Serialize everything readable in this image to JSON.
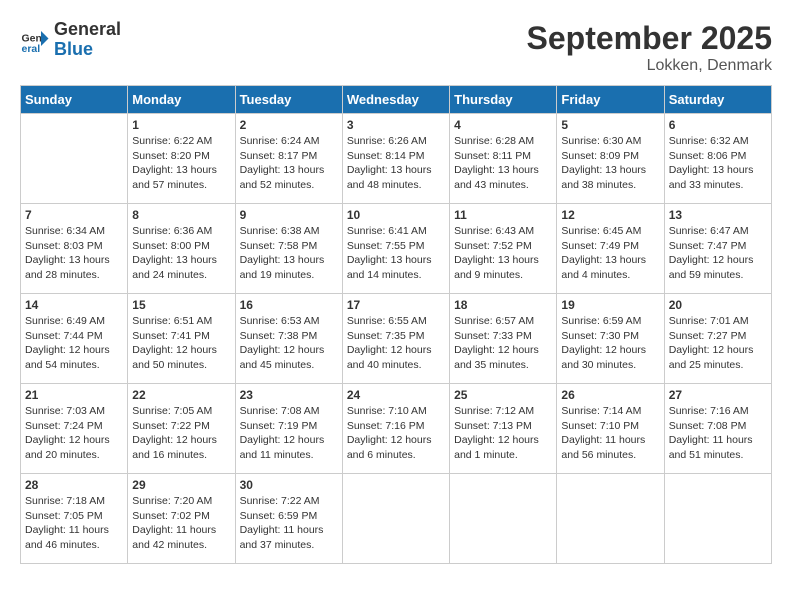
{
  "logo": {
    "general": "General",
    "blue": "Blue"
  },
  "title": "September 2025",
  "subtitle": "Lokken, Denmark",
  "days_header": [
    "Sunday",
    "Monday",
    "Tuesday",
    "Wednesday",
    "Thursday",
    "Friday",
    "Saturday"
  ],
  "weeks": [
    [
      {
        "day": "",
        "content": ""
      },
      {
        "day": "1",
        "sunrise": "Sunrise: 6:22 AM",
        "sunset": "Sunset: 8:20 PM",
        "daylight": "Daylight: 13 hours and 57 minutes."
      },
      {
        "day": "2",
        "sunrise": "Sunrise: 6:24 AM",
        "sunset": "Sunset: 8:17 PM",
        "daylight": "Daylight: 13 hours and 52 minutes."
      },
      {
        "day": "3",
        "sunrise": "Sunrise: 6:26 AM",
        "sunset": "Sunset: 8:14 PM",
        "daylight": "Daylight: 13 hours and 48 minutes."
      },
      {
        "day": "4",
        "sunrise": "Sunrise: 6:28 AM",
        "sunset": "Sunset: 8:11 PM",
        "daylight": "Daylight: 13 hours and 43 minutes."
      },
      {
        "day": "5",
        "sunrise": "Sunrise: 6:30 AM",
        "sunset": "Sunset: 8:09 PM",
        "daylight": "Daylight: 13 hours and 38 minutes."
      },
      {
        "day": "6",
        "sunrise": "Sunrise: 6:32 AM",
        "sunset": "Sunset: 8:06 PM",
        "daylight": "Daylight: 13 hours and 33 minutes."
      }
    ],
    [
      {
        "day": "7",
        "sunrise": "Sunrise: 6:34 AM",
        "sunset": "Sunset: 8:03 PM",
        "daylight": "Daylight: 13 hours and 28 minutes."
      },
      {
        "day": "8",
        "sunrise": "Sunrise: 6:36 AM",
        "sunset": "Sunset: 8:00 PM",
        "daylight": "Daylight: 13 hours and 24 minutes."
      },
      {
        "day": "9",
        "sunrise": "Sunrise: 6:38 AM",
        "sunset": "Sunset: 7:58 PM",
        "daylight": "Daylight: 13 hours and 19 minutes."
      },
      {
        "day": "10",
        "sunrise": "Sunrise: 6:41 AM",
        "sunset": "Sunset: 7:55 PM",
        "daylight": "Daylight: 13 hours and 14 minutes."
      },
      {
        "day": "11",
        "sunrise": "Sunrise: 6:43 AM",
        "sunset": "Sunset: 7:52 PM",
        "daylight": "Daylight: 13 hours and 9 minutes."
      },
      {
        "day": "12",
        "sunrise": "Sunrise: 6:45 AM",
        "sunset": "Sunset: 7:49 PM",
        "daylight": "Daylight: 13 hours and 4 minutes."
      },
      {
        "day": "13",
        "sunrise": "Sunrise: 6:47 AM",
        "sunset": "Sunset: 7:47 PM",
        "daylight": "Daylight: 12 hours and 59 minutes."
      }
    ],
    [
      {
        "day": "14",
        "sunrise": "Sunrise: 6:49 AM",
        "sunset": "Sunset: 7:44 PM",
        "daylight": "Daylight: 12 hours and 54 minutes."
      },
      {
        "day": "15",
        "sunrise": "Sunrise: 6:51 AM",
        "sunset": "Sunset: 7:41 PM",
        "daylight": "Daylight: 12 hours and 50 minutes."
      },
      {
        "day": "16",
        "sunrise": "Sunrise: 6:53 AM",
        "sunset": "Sunset: 7:38 PM",
        "daylight": "Daylight: 12 hours and 45 minutes."
      },
      {
        "day": "17",
        "sunrise": "Sunrise: 6:55 AM",
        "sunset": "Sunset: 7:35 PM",
        "daylight": "Daylight: 12 hours and 40 minutes."
      },
      {
        "day": "18",
        "sunrise": "Sunrise: 6:57 AM",
        "sunset": "Sunset: 7:33 PM",
        "daylight": "Daylight: 12 hours and 35 minutes."
      },
      {
        "day": "19",
        "sunrise": "Sunrise: 6:59 AM",
        "sunset": "Sunset: 7:30 PM",
        "daylight": "Daylight: 12 hours and 30 minutes."
      },
      {
        "day": "20",
        "sunrise": "Sunrise: 7:01 AM",
        "sunset": "Sunset: 7:27 PM",
        "daylight": "Daylight: 12 hours and 25 minutes."
      }
    ],
    [
      {
        "day": "21",
        "sunrise": "Sunrise: 7:03 AM",
        "sunset": "Sunset: 7:24 PM",
        "daylight": "Daylight: 12 hours and 20 minutes."
      },
      {
        "day": "22",
        "sunrise": "Sunrise: 7:05 AM",
        "sunset": "Sunset: 7:22 PM",
        "daylight": "Daylight: 12 hours and 16 minutes."
      },
      {
        "day": "23",
        "sunrise": "Sunrise: 7:08 AM",
        "sunset": "Sunset: 7:19 PM",
        "daylight": "Daylight: 12 hours and 11 minutes."
      },
      {
        "day": "24",
        "sunrise": "Sunrise: 7:10 AM",
        "sunset": "Sunset: 7:16 PM",
        "daylight": "Daylight: 12 hours and 6 minutes."
      },
      {
        "day": "25",
        "sunrise": "Sunrise: 7:12 AM",
        "sunset": "Sunset: 7:13 PM",
        "daylight": "Daylight: 12 hours and 1 minute."
      },
      {
        "day": "26",
        "sunrise": "Sunrise: 7:14 AM",
        "sunset": "Sunset: 7:10 PM",
        "daylight": "Daylight: 11 hours and 56 minutes."
      },
      {
        "day": "27",
        "sunrise": "Sunrise: 7:16 AM",
        "sunset": "Sunset: 7:08 PM",
        "daylight": "Daylight: 11 hours and 51 minutes."
      }
    ],
    [
      {
        "day": "28",
        "sunrise": "Sunrise: 7:18 AM",
        "sunset": "Sunset: 7:05 PM",
        "daylight": "Daylight: 11 hours and 46 minutes."
      },
      {
        "day": "29",
        "sunrise": "Sunrise: 7:20 AM",
        "sunset": "Sunset: 7:02 PM",
        "daylight": "Daylight: 11 hours and 42 minutes."
      },
      {
        "day": "30",
        "sunrise": "Sunrise: 7:22 AM",
        "sunset": "Sunset: 6:59 PM",
        "daylight": "Daylight: 11 hours and 37 minutes."
      },
      {
        "day": "",
        "content": ""
      },
      {
        "day": "",
        "content": ""
      },
      {
        "day": "",
        "content": ""
      },
      {
        "day": "",
        "content": ""
      }
    ]
  ]
}
